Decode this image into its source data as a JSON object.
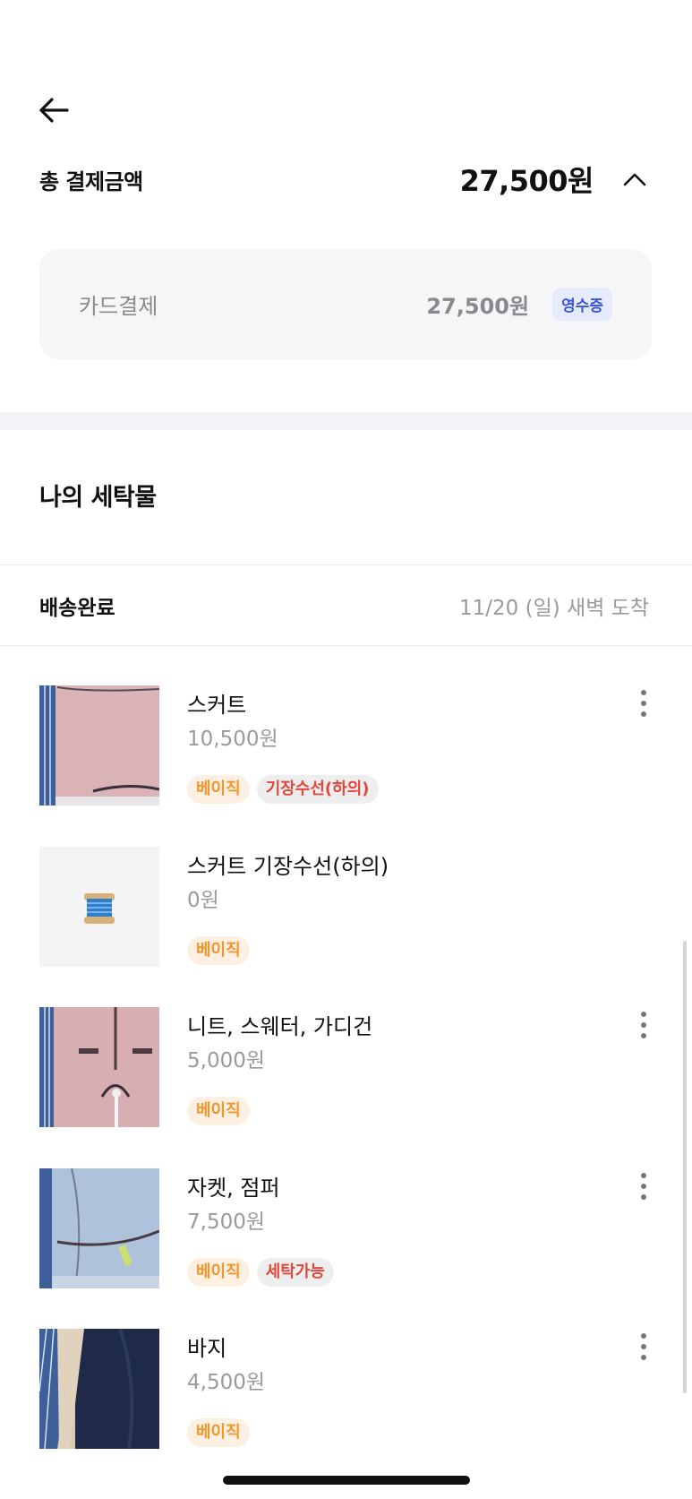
{
  "header": {
    "back_icon": "arrow-left-icon",
    "total_label": "총 결제금액",
    "total_amount": "27,500원",
    "collapse_icon": "chevron-up-icon"
  },
  "payment": {
    "method": "카드결제",
    "amount": "27,500원",
    "receipt_label": "영수증"
  },
  "laundry": {
    "section_title": "나의 세탁물",
    "status_label": "배송완료",
    "status_date": "11/20 (일) 새벽 도착",
    "items": [
      {
        "name": "스커트",
        "price": "10,500원",
        "tags": [
          "베이직",
          "기장수선(하의)"
        ],
        "has_menu": true,
        "image": "pink-skirt-photo"
      },
      {
        "name": "스커트 기장수선(하의)",
        "price": "0원",
        "tags": [
          "베이직"
        ],
        "has_menu": false,
        "image": "thread-spool-icon"
      },
      {
        "name": "니트, 스웨터, 가디건",
        "price": "5,000원",
        "tags": [
          "베이직"
        ],
        "has_menu": true,
        "image": "pink-cardigan-photo"
      },
      {
        "name": "자켓, 점퍼",
        "price": "7,500원",
        "tags": [
          "베이직",
          "세탁가능"
        ],
        "has_menu": true,
        "image": "blue-jacket-photo"
      },
      {
        "name": "바지",
        "price": "4,500원",
        "tags": [
          "베이직"
        ],
        "has_menu": true,
        "image": "navy-pants-photo"
      }
    ]
  },
  "colors": {
    "tag_orange": "#f0962b",
    "tag_red": "#e0473d",
    "receipt_blue": "#3a55d6"
  }
}
